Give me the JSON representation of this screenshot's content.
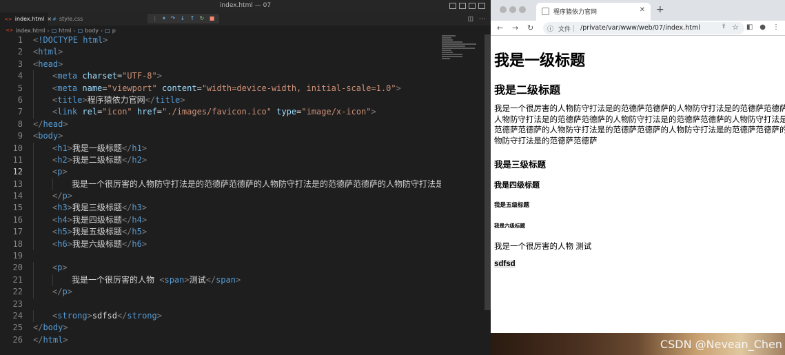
{
  "editor": {
    "window_title": "index.html — 07",
    "tabs": [
      {
        "label": "index.html",
        "icon": "html-file-icon",
        "active": true
      },
      {
        "label": "style.css",
        "icon": "css-file-icon",
        "active": false
      }
    ],
    "breadcrumb": [
      "index.html",
      "html",
      "body",
      "p"
    ],
    "code_lines": [
      {
        "n": "1",
        "parts": [
          [
            "g",
            "<"
          ],
          [
            "t",
            "!DOCTYPE html"
          ],
          [
            "g",
            ">"
          ]
        ]
      },
      {
        "n": "2",
        "parts": [
          [
            "g",
            "<"
          ],
          [
            "t",
            "html"
          ],
          [
            "g",
            ">"
          ]
        ]
      },
      {
        "n": "3",
        "parts": [
          [
            "g",
            "<"
          ],
          [
            "t",
            "head"
          ],
          [
            "g",
            ">"
          ]
        ]
      },
      {
        "n": "4",
        "indent": 1,
        "parts": [
          [
            "g",
            "<"
          ],
          [
            "t",
            "meta"
          ],
          [
            "c",
            " "
          ],
          [
            "a",
            "charset"
          ],
          [
            "c",
            "="
          ],
          [
            "s",
            "\"UTF-8\""
          ],
          [
            "g",
            ">"
          ]
        ]
      },
      {
        "n": "5",
        "indent": 1,
        "parts": [
          [
            "g",
            "<"
          ],
          [
            "t",
            "meta"
          ],
          [
            "c",
            " "
          ],
          [
            "a",
            "name"
          ],
          [
            "c",
            "="
          ],
          [
            "s",
            "\"viewport\""
          ],
          [
            "c",
            " "
          ],
          [
            "a",
            "content"
          ],
          [
            "c",
            "="
          ],
          [
            "s",
            "\"width=device-width, initial-scale=1.0\""
          ],
          [
            "g",
            ">"
          ]
        ]
      },
      {
        "n": "6",
        "indent": 1,
        "parts": [
          [
            "g",
            "<"
          ],
          [
            "t",
            "title"
          ],
          [
            "g",
            ">"
          ],
          [
            "c",
            "程序猿依力官网"
          ],
          [
            "g",
            "</"
          ],
          [
            "t",
            "title"
          ],
          [
            "g",
            ">"
          ]
        ]
      },
      {
        "n": "7",
        "indent": 1,
        "parts": [
          [
            "g",
            "<"
          ],
          [
            "t",
            "link"
          ],
          [
            "c",
            " "
          ],
          [
            "a",
            "rel"
          ],
          [
            "c",
            "="
          ],
          [
            "s",
            "\"icon\""
          ],
          [
            "c",
            " "
          ],
          [
            "a",
            "href"
          ],
          [
            "c",
            "="
          ],
          [
            "s",
            "\"./images/favicon.ico\""
          ],
          [
            "c",
            " "
          ],
          [
            "a",
            "type"
          ],
          [
            "c",
            "="
          ],
          [
            "s",
            "\"image/x-icon\""
          ],
          [
            "g",
            ">"
          ]
        ]
      },
      {
        "n": "8",
        "parts": [
          [
            "g",
            "</"
          ],
          [
            "t",
            "head"
          ],
          [
            "g",
            ">"
          ]
        ]
      },
      {
        "n": "9",
        "parts": [
          [
            "g",
            "<"
          ],
          [
            "t",
            "body"
          ],
          [
            "g",
            ">"
          ]
        ]
      },
      {
        "n": "10",
        "indent": 1,
        "parts": [
          [
            "g",
            "<"
          ],
          [
            "t",
            "h1"
          ],
          [
            "g",
            ">"
          ],
          [
            "c",
            "我是一级标题"
          ],
          [
            "g",
            "</"
          ],
          [
            "t",
            "h1"
          ],
          [
            "g",
            ">"
          ]
        ]
      },
      {
        "n": "11",
        "indent": 1,
        "parts": [
          [
            "g",
            "<"
          ],
          [
            "t",
            "h2"
          ],
          [
            "g",
            ">"
          ],
          [
            "c",
            "我是二级标题"
          ],
          [
            "g",
            "</"
          ],
          [
            "t",
            "h2"
          ],
          [
            "g",
            ">"
          ]
        ]
      },
      {
        "n": "12",
        "indent": 1,
        "current": true,
        "parts": [
          [
            "g",
            "<"
          ],
          [
            "t",
            "p"
          ],
          [
            "g",
            ">"
          ]
        ]
      },
      {
        "n": "13",
        "indent": 2,
        "parts": [
          [
            "c",
            "我是一个很厉害的人物防守打法是的范德萨范德萨的人物防守打法是的范德萨范德萨的人物防守打法是的范"
          ]
        ]
      },
      {
        "n": "14",
        "indent": 1,
        "parts": [
          [
            "g",
            "</"
          ],
          [
            "t",
            "p"
          ],
          [
            "g",
            ">"
          ]
        ]
      },
      {
        "n": "15",
        "indent": 1,
        "parts": [
          [
            "g",
            "<"
          ],
          [
            "t",
            "h3"
          ],
          [
            "g",
            ">"
          ],
          [
            "c",
            "我是三级标题"
          ],
          [
            "g",
            "</"
          ],
          [
            "t",
            "h3"
          ],
          [
            "g",
            ">"
          ]
        ]
      },
      {
        "n": "16",
        "indent": 1,
        "parts": [
          [
            "g",
            "<"
          ],
          [
            "t",
            "h4"
          ],
          [
            "g",
            ">"
          ],
          [
            "c",
            "我是四级标题"
          ],
          [
            "g",
            "</"
          ],
          [
            "t",
            "h4"
          ],
          [
            "g",
            ">"
          ]
        ]
      },
      {
        "n": "17",
        "indent": 1,
        "parts": [
          [
            "g",
            "<"
          ],
          [
            "t",
            "h5"
          ],
          [
            "g",
            ">"
          ],
          [
            "c",
            "我是五级标题"
          ],
          [
            "g",
            "</"
          ],
          [
            "t",
            "h5"
          ],
          [
            "g",
            ">"
          ]
        ]
      },
      {
        "n": "18",
        "indent": 1,
        "parts": [
          [
            "g",
            "<"
          ],
          [
            "t",
            "h6"
          ],
          [
            "g",
            ">"
          ],
          [
            "c",
            "我是六级标题"
          ],
          [
            "g",
            "</"
          ],
          [
            "t",
            "h6"
          ],
          [
            "g",
            ">"
          ]
        ]
      },
      {
        "n": "19",
        "parts": []
      },
      {
        "n": "20",
        "indent": 1,
        "parts": [
          [
            "g",
            "<"
          ],
          [
            "t",
            "p"
          ],
          [
            "g",
            ">"
          ]
        ]
      },
      {
        "n": "21",
        "indent": 2,
        "parts": [
          [
            "c",
            "我是一个很厉害的人物 "
          ],
          [
            "g",
            "<"
          ],
          [
            "t",
            "span"
          ],
          [
            "g",
            ">"
          ],
          [
            "c",
            "测试"
          ],
          [
            "g",
            "</"
          ],
          [
            "t",
            "span"
          ],
          [
            "g",
            ">"
          ]
        ]
      },
      {
        "n": "22",
        "indent": 1,
        "parts": [
          [
            "g",
            "</"
          ],
          [
            "t",
            "p"
          ],
          [
            "g",
            ">"
          ]
        ]
      },
      {
        "n": "23",
        "parts": []
      },
      {
        "n": "24",
        "indent": 1,
        "parts": [
          [
            "g",
            "<"
          ],
          [
            "t",
            "strong"
          ],
          [
            "g",
            ">"
          ],
          [
            "c",
            "sdfsd"
          ],
          [
            "g",
            "</"
          ],
          [
            "t",
            "strong"
          ],
          [
            "g",
            ">"
          ]
        ]
      },
      {
        "n": "25",
        "parts": [
          [
            "g",
            "</"
          ],
          [
            "t",
            "body"
          ],
          [
            "g",
            ">"
          ]
        ]
      },
      {
        "n": "26",
        "parts": [
          [
            "g",
            "</"
          ],
          [
            "t",
            "html"
          ],
          [
            "g",
            ">"
          ]
        ]
      }
    ]
  },
  "browser": {
    "tab_title": "程序猿依力官网",
    "address_label": "文件",
    "url": "/private/var/www/web/07/index.html",
    "page": {
      "h1": "我是一级标题",
      "h2": "我是二级标题",
      "paragraph": "我是一个很厉害的人物防守打法是的范德萨范德萨的人物防守打法是的范德萨范德萨的人物防守打法是的范德萨范德萨的人物防守打法是的范德萨范德萨的人物防守打法是的范德萨范德萨的人物防守打法是的范德萨范德萨的人物防守打法是的范德萨范德萨的人物防守打法是的范德萨范德萨",
      "h3": "我是三级标题",
      "h4": "我是四级标题",
      "h5": "我是五级标题",
      "h6": "我是六级标题",
      "p2": "我是一个很厉害的人物 测试",
      "strong": "sdfsd"
    },
    "watermark": "CSDN @Nevean_Chen"
  },
  "colors": {
    "tag": "#569cd6",
    "attr": "#9cdcfe",
    "string": "#ce9178",
    "bracket": "#808080"
  }
}
